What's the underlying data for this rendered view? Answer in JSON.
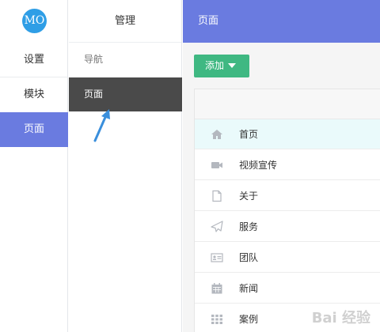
{
  "logo": {
    "text": "MO"
  },
  "nav_primary": {
    "items": [
      {
        "label": "设置"
      },
      {
        "label": "模块"
      },
      {
        "label": "页面"
      }
    ]
  },
  "nav_secondary": {
    "header": "管理",
    "items": [
      {
        "label": "导航"
      },
      {
        "label": "页面"
      }
    ]
  },
  "topbar": {
    "title": "页面"
  },
  "toolbar": {
    "add_label": "添加"
  },
  "list": {
    "rows": [
      {
        "label": "首页",
        "icon": "home-icon"
      },
      {
        "label": "视频宣传",
        "icon": "video-icon"
      },
      {
        "label": "关于",
        "icon": "file-icon"
      },
      {
        "label": "服务",
        "icon": "send-icon"
      },
      {
        "label": "团队",
        "icon": "id-card-icon"
      },
      {
        "label": "新闻",
        "icon": "calendar-icon"
      },
      {
        "label": "案例",
        "icon": "grid-icon"
      }
    ]
  },
  "watermark": {
    "text": "Bai 经验"
  },
  "colors": {
    "accent": "#6a7be0",
    "add_button": "#3fb882",
    "active_dark": "#4a4a4a",
    "logo": "#2f9ee6"
  }
}
